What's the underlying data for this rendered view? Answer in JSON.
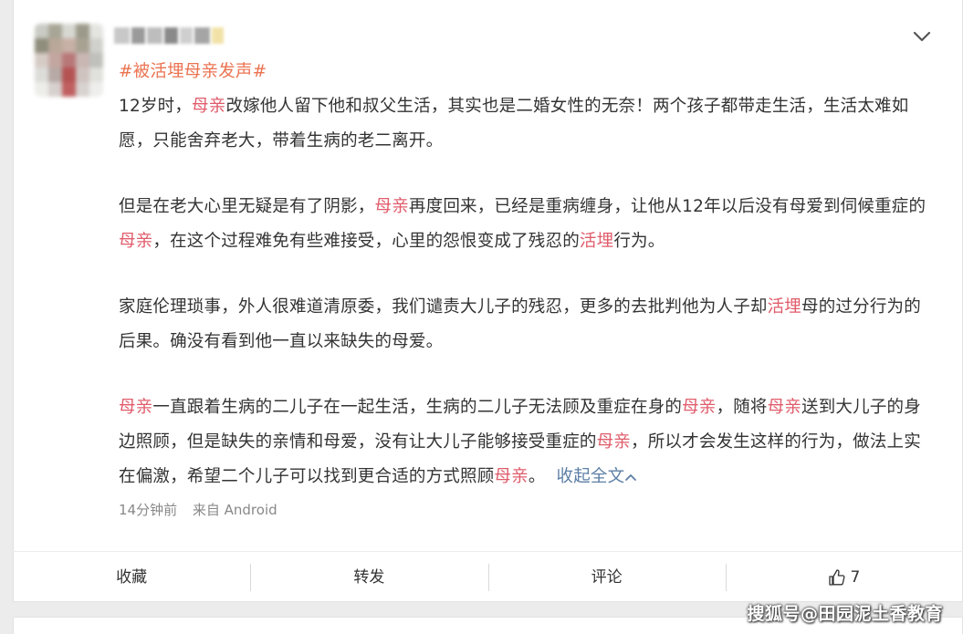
{
  "post": {
    "hashtag": "#被活埋母亲发声#",
    "paragraphs": [
      [
        {
          "t": "12岁时，"
        },
        {
          "t": "母亲",
          "h": true
        },
        {
          "t": "改嫁他人留下他和叔父生活，其实也是二婚女性的无奈！两个孩子都带走生活，生活太难如愿，只能舍弃老大，带着生病的老二离开。"
        }
      ],
      [
        {
          "t": "但是在老大心里无疑是有了阴影，"
        },
        {
          "t": "母亲",
          "h": true
        },
        {
          "t": "再度回来，已经是重病缠身，让他从12年以后没有母爱到伺候重症的"
        },
        {
          "t": "母亲",
          "h": true
        },
        {
          "t": "，在这个过程难免有些难接受，心里的怨恨变成了残忍的"
        },
        {
          "t": "活埋",
          "h": true
        },
        {
          "t": "行为。"
        }
      ],
      [
        {
          "t": "家庭伦理琐事，外人很难道清原委，我们谴责大儿子的残忍，更多的去批判他为人子却"
        },
        {
          "t": "活埋",
          "h": true
        },
        {
          "t": "母的过分行为的后果。确没有看到他一直以来缺失的母爱。"
        }
      ],
      [
        {
          "t": "母亲",
          "h": true
        },
        {
          "t": "一直跟着生病的二儿子在一起生活，生病的二儿子无法顾及重症在身的"
        },
        {
          "t": "母亲",
          "h": true
        },
        {
          "t": "，随将"
        },
        {
          "t": "母亲",
          "h": true
        },
        {
          "t": "送到大儿子的身边照顾，但是缺失的亲情和母爱，没有让大儿子能够接受重症的"
        },
        {
          "t": "母亲",
          "h": true
        },
        {
          "t": "，所以才会发生这样的行为，做法上实在偏激，希望二个儿子可以找到更合适的方式照顾"
        },
        {
          "t": "母亲",
          "h": true
        },
        {
          "t": "。"
        }
      ]
    ],
    "collapse_label": "收起全文",
    "time": "14分钟前",
    "source": "来自 Android"
  },
  "actions": {
    "favorite": "收藏",
    "repost": "转发",
    "comment": "评论",
    "like_count": "7"
  },
  "watermark": "搜狐号@田园泥土香教育",
  "colors": {
    "highlight": "#e05c6b",
    "hashtag": "#eb7350",
    "link": "#5d7fa6",
    "meta": "#888888",
    "text": "#333333"
  }
}
